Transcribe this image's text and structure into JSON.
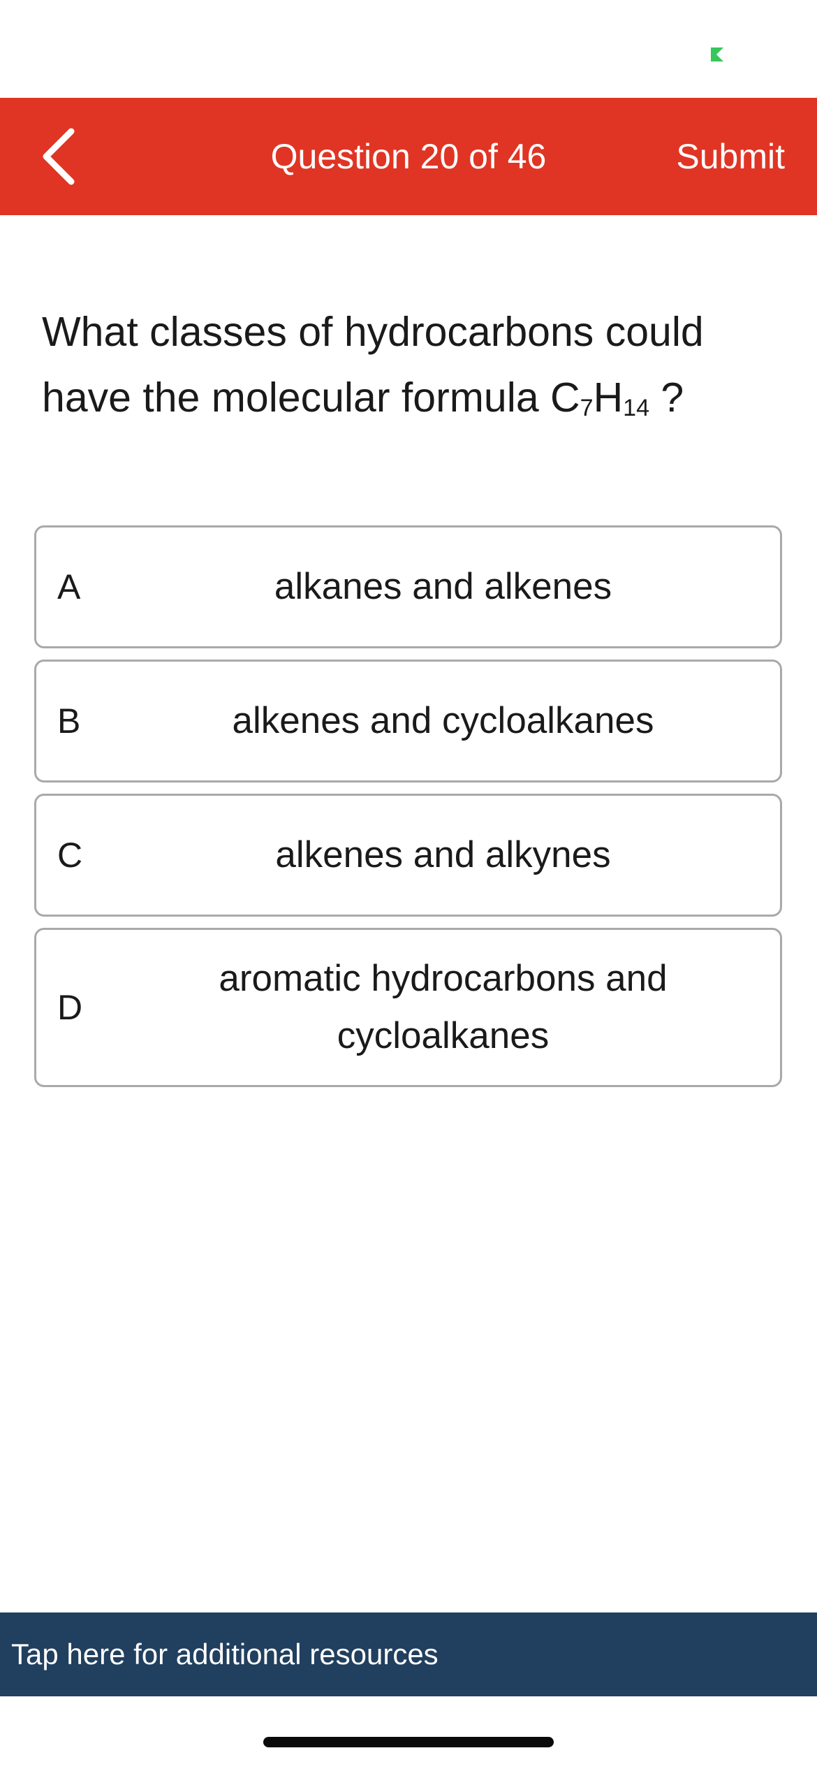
{
  "status_bar": {
    "indicator_icon": "green-dot-icon",
    "indicator_color": "#34c759"
  },
  "header": {
    "back_icon": "chevron-left-icon",
    "title": "Question 20 of 46",
    "submit_label": "Submit",
    "background_color": "#e03524"
  },
  "question": {
    "text_before": "What classes of hydrocarbons could have the molecular formula C",
    "subscript_1": "7",
    "text_middle": "H",
    "subscript_2": "14",
    "text_after": " ?"
  },
  "options": [
    {
      "letter": "A",
      "text": "alkanes and alkenes"
    },
    {
      "letter": "B",
      "text": "alkenes and cycloalkanes"
    },
    {
      "letter": "C",
      "text": "alkenes and alkynes"
    },
    {
      "letter": "D",
      "text": "aromatic hydrocarbons and cycloalkanes"
    }
  ],
  "footer": {
    "resources_label": "Tap here for additional resources",
    "background_color": "#213f5e"
  }
}
